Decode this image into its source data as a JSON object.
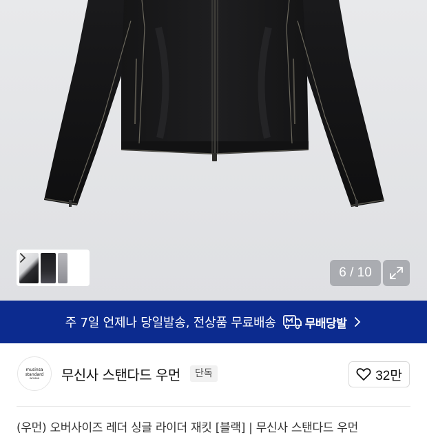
{
  "gallery": {
    "counter": "6 / 10",
    "thumb_arrow_icon": "chevron-right-icon",
    "expand_icon": "expand-icon"
  },
  "banner": {
    "text": "주 7일 언제나 당일발송, 전상품 무료배송",
    "logo_text": "무배당발",
    "logo_icon": "truck-m-icon",
    "chevron_icon": "chevron-right-icon",
    "color": "#0c2b8f"
  },
  "brand": {
    "logo_line1": "musinsa",
    "logo_line2": "standard",
    "logo_line3": "WOMAN",
    "name": "무신사 스탠다드 우먼",
    "tag": "단독",
    "like_icon": "heart-outline-icon",
    "like_count": "32만"
  },
  "below": {
    "cut_text": "(우먼) 오버사이즈 레더 싱글 라이더 재킷 [블랙] | 무신사 스탠다드 우먼"
  }
}
